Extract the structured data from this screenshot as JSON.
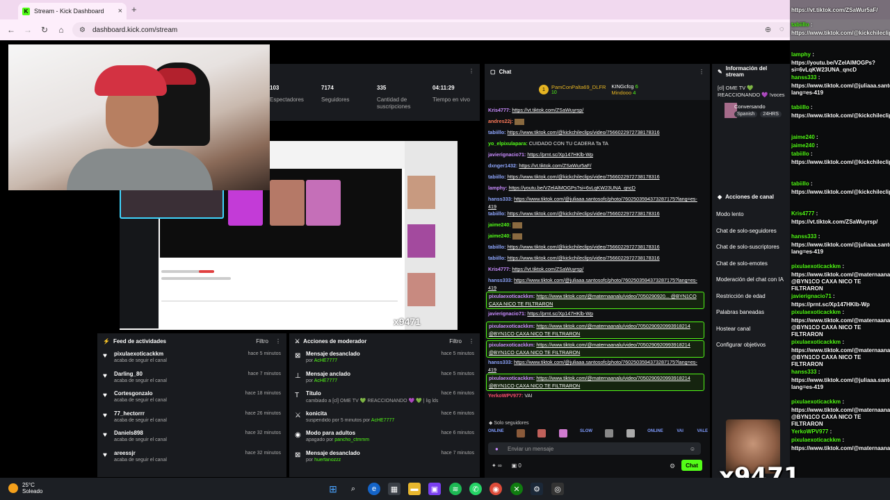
{
  "browser": {
    "tab_title": "Stream - Kick Dashboard",
    "favicon": "K",
    "url": "dashboard.kick.com/stream",
    "new_tab": "+"
  },
  "stats": [
    {
      "value": "103",
      "label": "Espectadores"
    },
    {
      "value": "7174",
      "label": "Seguidores"
    },
    {
      "value": "335",
      "label": "Cantidad de suscripciones"
    },
    {
      "value": "04:11:29",
      "label": "Tiempo en vivo"
    }
  ],
  "preview": {
    "watermark": "x9471"
  },
  "feed": {
    "title": "Feed de actividades",
    "filter": "Filtro",
    "items": [
      {
        "name": "pixulaexoticackkm",
        "action": "acaba de seguir el canal",
        "time": "hace 5 minutos"
      },
      {
        "name": "Darling_80",
        "action": "acaba de seguir el canal",
        "time": "hace 7 minutos"
      },
      {
        "name": "Cortesgonzalo",
        "action": "acaba de seguir el canal",
        "time": "hace 18 minutos"
      },
      {
        "name": "77_hectorrr",
        "action": "acaba de seguir el canal",
        "time": "hace 26 minutos"
      },
      {
        "name": "Daniels898",
        "action": "acaba de seguir el canal",
        "time": "hace 32 minutos"
      },
      {
        "name": "areessjr",
        "action": "acaba de seguir el canal",
        "time": "hace 32 minutos"
      }
    ]
  },
  "mod_actions": {
    "title": "Acciones de moderador",
    "filter": "Filtro",
    "items": [
      {
        "title": "Mensaje desanclado",
        "prefix": "por",
        "user": "AcHE7777",
        "time": "hace 5 minutos",
        "icon": "unpin-icon"
      },
      {
        "title": "Mensaje anclado",
        "prefix": "por",
        "user": "AcHE7777",
        "time": "hace 5 minutos",
        "icon": "pin-icon"
      },
      {
        "title": "Título",
        "prefix": "cambiado a [cl] OME TV 💚 REACCIONANDO 💜 💚 | lig lds !voces por",
        "user": "BYN1CO",
        "time": "hace 6 minutos",
        "icon": "title-icon"
      },
      {
        "title": "konicita",
        "prefix": "suspendido por 5 minutos por",
        "user": "AcHE7777",
        "time": "hace 6 minutos",
        "icon": "timeout-icon"
      },
      {
        "title": "Modo para adultos",
        "prefix": "apagado por",
        "user": "pancho_ctmmm",
        "time": "hace 6 minutos",
        "icon": "eye-icon"
      },
      {
        "title": "Mensaje desanclado",
        "prefix": "por",
        "user": "huerfanozzz",
        "time": "hace 7 minutos",
        "icon": "unpin-icon"
      }
    ]
  },
  "chat": {
    "title": "Chat",
    "pinned": {
      "user1": "PamConPalta69_DLFR",
      "count1": "10",
      "user2": "KINGcfcg",
      "count2": "6",
      "user3": "Mindooo",
      "count3": "4"
    },
    "messages": [
      {
        "user": "Kris4777:",
        "text": "https://vt.tiktok.com/ZSaWuyrsp/",
        "color": "#c98cff",
        "hl": false
      },
      {
        "user": "andres22j:",
        "text": "",
        "color": "#ff7a59",
        "hl": false
      },
      {
        "user": "tabiillo:",
        "text": "https://www.tiktok.com/@kickchileclips/video/7566022972738178316",
        "color": "#8fa7ff",
        "hl": false
      },
      {
        "user": "yo_elpixulapara:",
        "text": "CUIDADO CON TU CADERA Ta TA",
        "color": "#53fc18",
        "hl": false
      },
      {
        "user": "javierignacio71:",
        "text": "https://prnt.sc/Xp147HKlb-Wp",
        "color": "#c98cff",
        "hl": false
      },
      {
        "user": "dxnger1432:",
        "text": "https://vt.tiktok.com/ZSaWur5aF/",
        "color": "#8fa7ff",
        "hl": false
      },
      {
        "user": "tabiillo:",
        "text": "https://www.tiktok.com/@kickchileclips/video/7566022972738178316",
        "color": "#8fa7ff",
        "hl": false
      },
      {
        "user": "lamphy:",
        "text": "https://youtu.be/VZelAlMOGPs?si=6vLqKW23UNA_qncD",
        "color": "#c98cff",
        "hl": false
      },
      {
        "user": "hanss333:",
        "text": "https://www.tiktok.com/@juliaaa.santosofc/photo/7602503594373287175?lang=es-419",
        "color": "#8fa7ff",
        "hl": false
      },
      {
        "user": "tabiillo:",
        "text": "https://www.tiktok.com/@kickchileclips/video/7566022972738178316",
        "color": "#8fa7ff",
        "hl": false
      },
      {
        "user": "jaime240:",
        "text": "",
        "color": "#53fc18",
        "hl": false
      },
      {
        "user": "jaime240:",
        "text": "",
        "color": "#53fc18",
        "hl": false
      },
      {
        "user": "tabiillo:",
        "text": "https://www.tiktok.com/@kickchileclips/video/7566022972738178316",
        "color": "#8fa7ff",
        "hl": false
      },
      {
        "user": "tabiillo:",
        "text": "https://www.tiktok.com/@kickchileclips/video/7566022972738178316",
        "color": "#8fa7ff",
        "hl": false
      },
      {
        "user": "Kris4777:",
        "text": "https://vt.tiktok.com/ZSaWuyrsp/",
        "color": "#c98cff",
        "hl": false
      },
      {
        "user": "hanss333:",
        "text": "https://www.tiktok.com/@juliaaa.santosofc/photo/7602503594373287175?lang=es-419",
        "color": "#8fa7ff",
        "hl": false
      },
      {
        "user": "pixulaexoticackkm:",
        "text": "https://www.tiktok.com/@maternaanalu/video/7050290920... @BYN1CO CAXA NICO TE FILTRARON",
        "color": "#c98cff",
        "hl": true
      },
      {
        "user": "javierignacio71:",
        "text": "https://prnt.sc/Xp147HKlb-Wp",
        "color": "#c98cff",
        "hl": false
      },
      {
        "user": "pixulaexoticackkm:",
        "text": "https://www.tiktok.com/@maternaanalu/video/7050290920993918214 @BYN1CO CAXA NICO TE FILTRARON",
        "color": "#c98cff",
        "hl": true
      },
      {
        "user": "pixulaexoticackkm:",
        "text": "https://www.tiktok.com/@maternaanalu/video/7050290920993918214 @BYN1CO CAXA NICO TE FILTRARON",
        "color": "#c98cff",
        "hl": true
      },
      {
        "user": "hanss333:",
        "text": "https://www.tiktok.com/@juliaaa.santosofc/photo/7602503594373287175?lang=es-419",
        "color": "#8fa7ff",
        "hl": false
      },
      {
        "user": "pixulaexoticackkm:",
        "text": "https://www.tiktok.com/@maternaanalu/video/7050290920993918214 @BYN1CO CAXA NICO TE FILTRARON",
        "color": "#c98cff",
        "hl": true
      },
      {
        "user": "YerkoWPV977:",
        "text": "VAI",
        "color": "#ff4d6d",
        "hl": false
      }
    ],
    "followers_only": "Solo seguidores",
    "emotes": [
      "ONLINE",
      "",
      "",
      "",
      "SLOW",
      "",
      "",
      "ONLINE",
      "VAI",
      "VALE"
    ],
    "input_placeholder": "Enviar un mensaje",
    "points": "∞",
    "gifts": "0",
    "send": "Chat"
  },
  "stream_info": {
    "title": "Información del stream",
    "stream_title": "[cl] OME TV 💚 REACCIONANDO 💜 !voces",
    "category": "Conversando",
    "tags": [
      "Spanish",
      "24HRS"
    ]
  },
  "channel_actions": {
    "title": "Acciones de canal",
    "items": [
      "Modo lento",
      "Chat de solo-seguidores",
      "Chat de solo-suscriptores",
      "Chat de solo-emotes",
      "Moderación del chat con IA",
      "Restricción de edad",
      "Palabras baneadas",
      "Hostear canal",
      "Configurar objetivos"
    ]
  },
  "overlay_chat": {
    "lines": [
      {
        "u": "",
        "t": "https://vt.tiktok.com/ZSaWur5aF/"
      },
      {
        "u": "tabiillo",
        "t": ""
      },
      {
        "u": "",
        "t": "https://www.tiktok.com/@kickchileclips/video/7566022972738178316"
      },
      {
        "u": "lamphy",
        "t": ""
      },
      {
        "u": "",
        "t": "https://youtu.be/VZelAlMOGPs?si=6vLqKW23UNA_qncD"
      },
      {
        "u": "hanss333",
        "t": ""
      },
      {
        "u": "",
        "t": "https://www.tiktok.com/@juliaaa.santosofc/photo/7602503594373287175?lang=es-419"
      },
      {
        "u": "tabiillo",
        "t": ""
      },
      {
        "u": "",
        "t": "https://www.tiktok.com/@kickchileclips/video/7566022972738178316"
      },
      {
        "u": "jaime240",
        "t": ""
      },
      {
        "u": "jaime240",
        "t": ""
      },
      {
        "u": "tabiillo",
        "t": ""
      },
      {
        "u": "",
        "t": "https://www.tiktok.com/@kickchileclips/video/7566022972738178316"
      },
      {
        "u": "tabiillo",
        "t": ""
      },
      {
        "u": "",
        "t": "https://www.tiktok.com/@kickchileclips/video/7566022972738178316"
      },
      {
        "u": "Kris4777",
        "t": ""
      },
      {
        "u": "",
        "t": "https://vt.tiktok.com/ZSaWuyrsp/"
      },
      {
        "u": "hanss333",
        "t": ""
      },
      {
        "u": "",
        "t": "https://www.tiktok.com/@juliaaa.santosofc/photo/7602503594373287175?lang=es-419"
      },
      {
        "u": "pixulaexoticackkm",
        "t": ""
      },
      {
        "u": "",
        "t": "https://www.tiktok.com/@maternaanalu/video/7050290920993918214 @BYN1CO CAXA NICO TE FILTRARON"
      },
      {
        "u": "javierignacio71",
        "t": ""
      },
      {
        "u": "",
        "t": "https://prnt.sc/Xp147HKlb-Wp"
      },
      {
        "u": "pixulaexoticackkm",
        "t": ""
      },
      {
        "u": "",
        "t": "https://www.tiktok.com/@maternaanalu/video/7050290920993918214 @BYN1CO CAXA NICO TE FILTRARON"
      },
      {
        "u": "pixulaexoticackkm",
        "t": ""
      },
      {
        "u": "",
        "t": "https://www.tiktok.com/@maternaanalu/video/7050290920993918214 @BYN1CO CAXA NICO TE FILTRARON"
      },
      {
        "u": "hanss333",
        "t": ""
      },
      {
        "u": "",
        "t": "https://www.tiktok.com/@juliaaa.santosofc/photo/7602503594373287175?lang=es-419"
      },
      {
        "u": "pixulaexoticackkm",
        "t": ""
      },
      {
        "u": "",
        "t": "https://www.tiktok.com/@maternaanalu/video/7050290920993918214 @BYN1CO CAXA NICO TE FILTRARON"
      },
      {
        "u": "YerkoWPV977",
        "t": ""
      },
      {
        "u": "pixulaexoticackkm",
        "t": ""
      },
      {
        "u": "",
        "t": "https://www.tiktok.com/@maternaanalu/video/7050290920993918214"
      }
    ],
    "watermark": "x9471"
  },
  "taskbar": {
    "temp": "25°C",
    "condition": "Soleado"
  }
}
